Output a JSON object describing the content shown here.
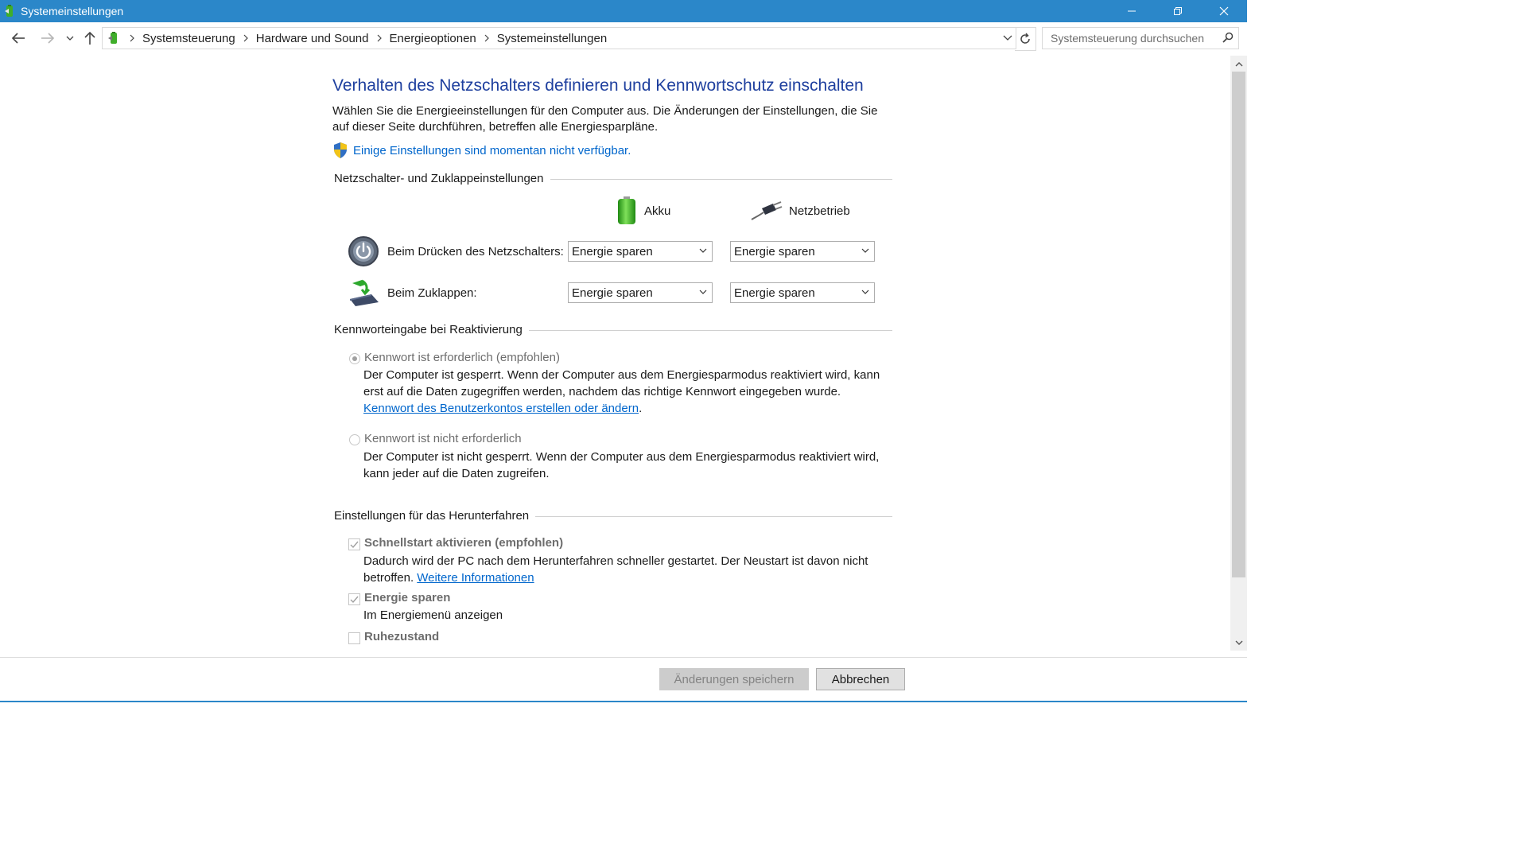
{
  "window": {
    "title": "Systemeinstellungen",
    "accent": "#2b87c9"
  },
  "address": {
    "crumbs": [
      "Systemsteuerung",
      "Hardware und Sound",
      "Energieoptionen",
      "Systemeinstellungen"
    ],
    "search_placeholder": "Systemsteuerung durchsuchen"
  },
  "page": {
    "title": "Verhalten des Netzschalters definieren und Kennwortschutz einschalten",
    "description": "Wählen Sie die Energieeinstellungen für den Computer aus. Die Änderungen der Einstellungen, die Sie auf dieser Seite durchführen, betreffen alle Energiesparpläne.",
    "unavailable_link": "Einige Einstellungen sind momentan nicht verfügbar."
  },
  "power_section": {
    "title": "Netzschalter- und Zuklappeinstellungen",
    "col_battery": "Akku",
    "col_ac": "Netzbetrieb",
    "rows": [
      {
        "label": "Beim Drücken des Netzschalters:",
        "battery": "Energie sparen",
        "ac": "Energie sparen"
      },
      {
        "label": "Beim Zuklappen:",
        "battery": "Energie sparen",
        "ac": "Energie sparen"
      }
    ]
  },
  "password_section": {
    "title": "Kennworteingabe bei Reaktivierung",
    "required_label": "Kennwort ist erforderlich (empfohlen)",
    "required_desc": "Der Computer ist gesperrt. Wenn der Computer aus dem Energiesparmodus reaktiviert wird, kann erst auf die Daten zugegriffen werden, nachdem das richtige Kennwort eingegeben wurde.",
    "account_link": "Kennwort des Benutzerkontos erstellen oder ändern",
    "account_link_suffix": ".",
    "not_required_label": "Kennwort ist nicht erforderlich",
    "not_required_desc": "Der Computer ist nicht gesperrt. Wenn der Computer aus dem Energiesparmodus reaktiviert wird, kann jeder auf die Daten zugreifen.",
    "selected": "required"
  },
  "shutdown_section": {
    "title": "Einstellungen für das Herunterfahren",
    "fast_startup_label": "Schnellstart aktivieren (empfohlen)",
    "fast_startup_desc": "Dadurch wird der PC nach dem Herunterfahren schneller gestartet. Der Neustart ist davon nicht betroffen.",
    "more_info_link": "Weitere Informationen",
    "sleep_label": "Energie sparen",
    "sleep_desc": "Im Energiemenü anzeigen",
    "hibernate_label": "Ruhezustand"
  },
  "buttons": {
    "save": "Änderungen speichern",
    "cancel": "Abbrechen"
  }
}
